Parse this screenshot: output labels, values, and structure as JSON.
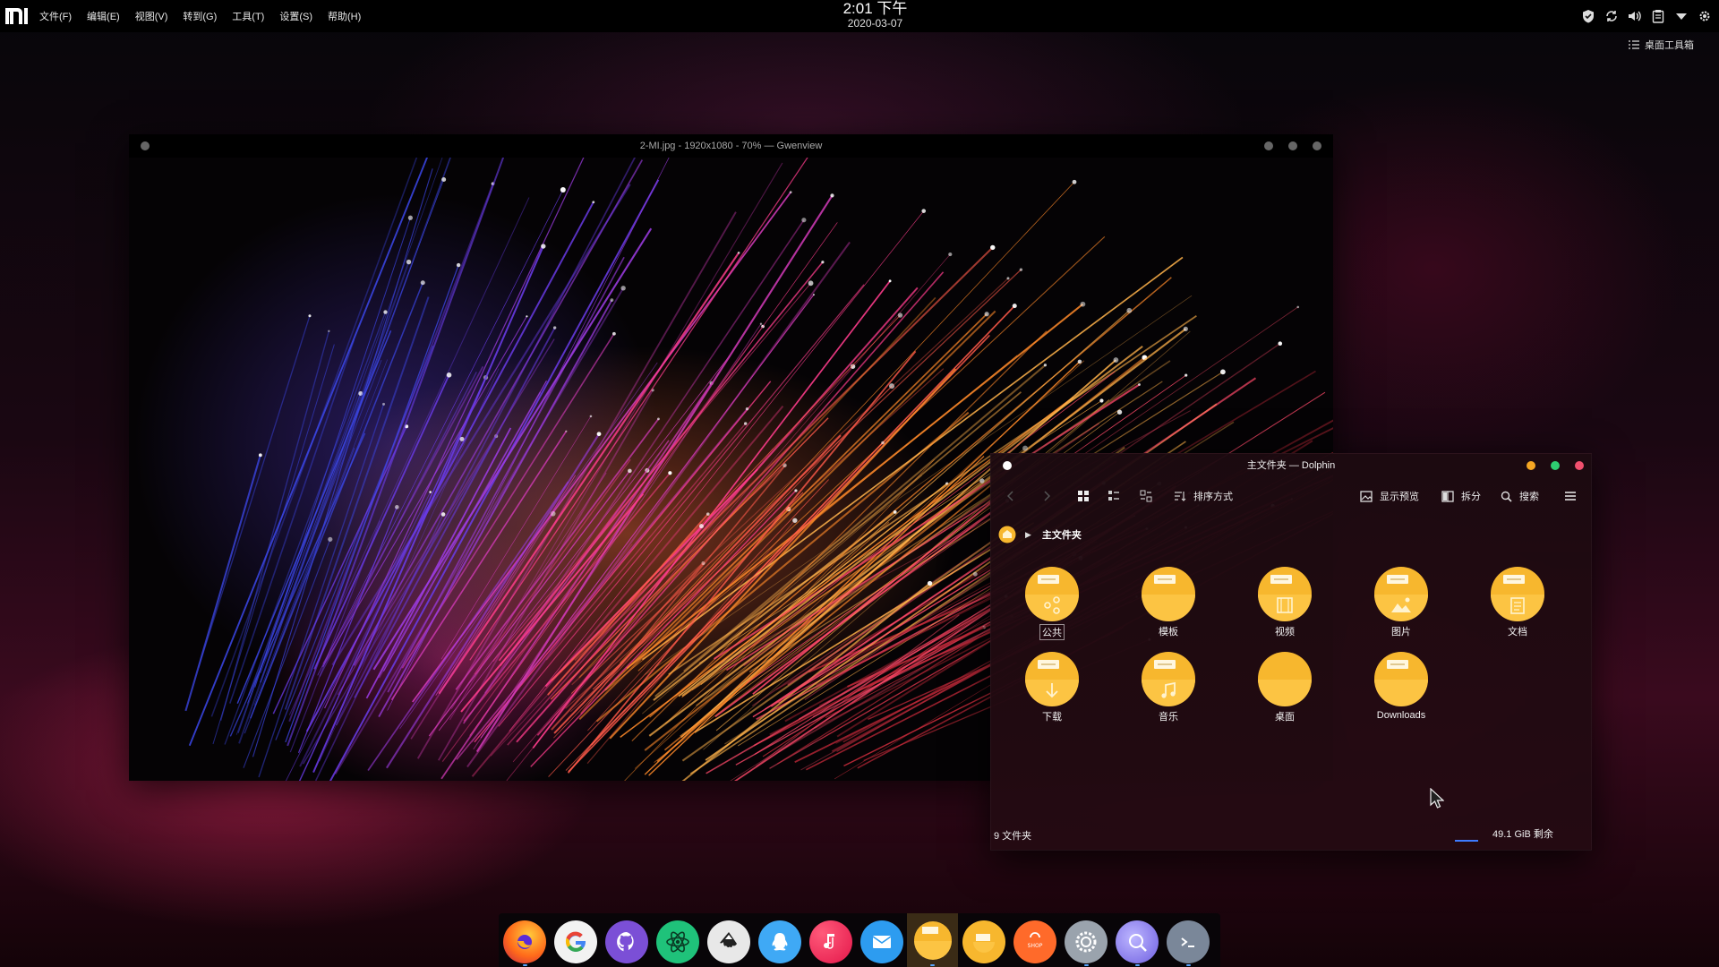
{
  "topbar": {
    "menus": [
      "文件(F)",
      "编辑(E)",
      "视图(V)",
      "转到(G)",
      "工具(T)",
      "设置(S)",
      "帮助(H)"
    ],
    "clock": {
      "time": "2:01 下午",
      "date": "2020-03-07"
    },
    "tray_icons": [
      "shield-icon",
      "sync-icon",
      "volume-icon",
      "clipboard-icon",
      "expand-arrow-icon",
      "settings-gear-icon"
    ]
  },
  "desktop": {
    "toolbox_label": "桌面工具箱"
  },
  "gwenview": {
    "title": "2-MI.jpg - 1920x1080 - 70% — Gwenview"
  },
  "dolphin": {
    "title": "主文件夹 — Dolphin",
    "toolbar": {
      "sort_label": "排序方式",
      "preview_label": "显示预览",
      "split_label": "拆分",
      "search_label": "搜索"
    },
    "breadcrumb": "主文件夹",
    "folders": [
      {
        "label": "公共",
        "emblem": "share"
      },
      {
        "label": "模板",
        "emblem": "template"
      },
      {
        "label": "视频",
        "emblem": "film"
      },
      {
        "label": "图片",
        "emblem": "picture"
      },
      {
        "label": "文档",
        "emblem": "document"
      },
      {
        "label": "下载",
        "emblem": "download"
      },
      {
        "label": "音乐",
        "emblem": "music"
      },
      {
        "label": "桌面",
        "emblem": "desktop"
      },
      {
        "label": "Downloads",
        "emblem": "template"
      }
    ],
    "status": {
      "count": "9 文件夹",
      "free_space": "49.1 GiB 剩余"
    },
    "accent": "#3d7bff"
  },
  "dock": {
    "apps": [
      "firefox-icon",
      "google-chrome-icon",
      "github-desktop-icon",
      "atom-editor-icon",
      "inkscape-icon",
      "qq-icon",
      "music-player-icon",
      "mail-icon",
      "dolphin-files-icon",
      "file-manager-icon",
      "app-store-icon",
      "system-settings-icon",
      "image-viewer-icon",
      "terminal-icon"
    ]
  },
  "colors": {
    "folder": "#f7b72e",
    "folder_light": "#fcd25a",
    "close": "#f0506e",
    "maximize": "#2ecc71",
    "minimize": "#f5a623"
  }
}
